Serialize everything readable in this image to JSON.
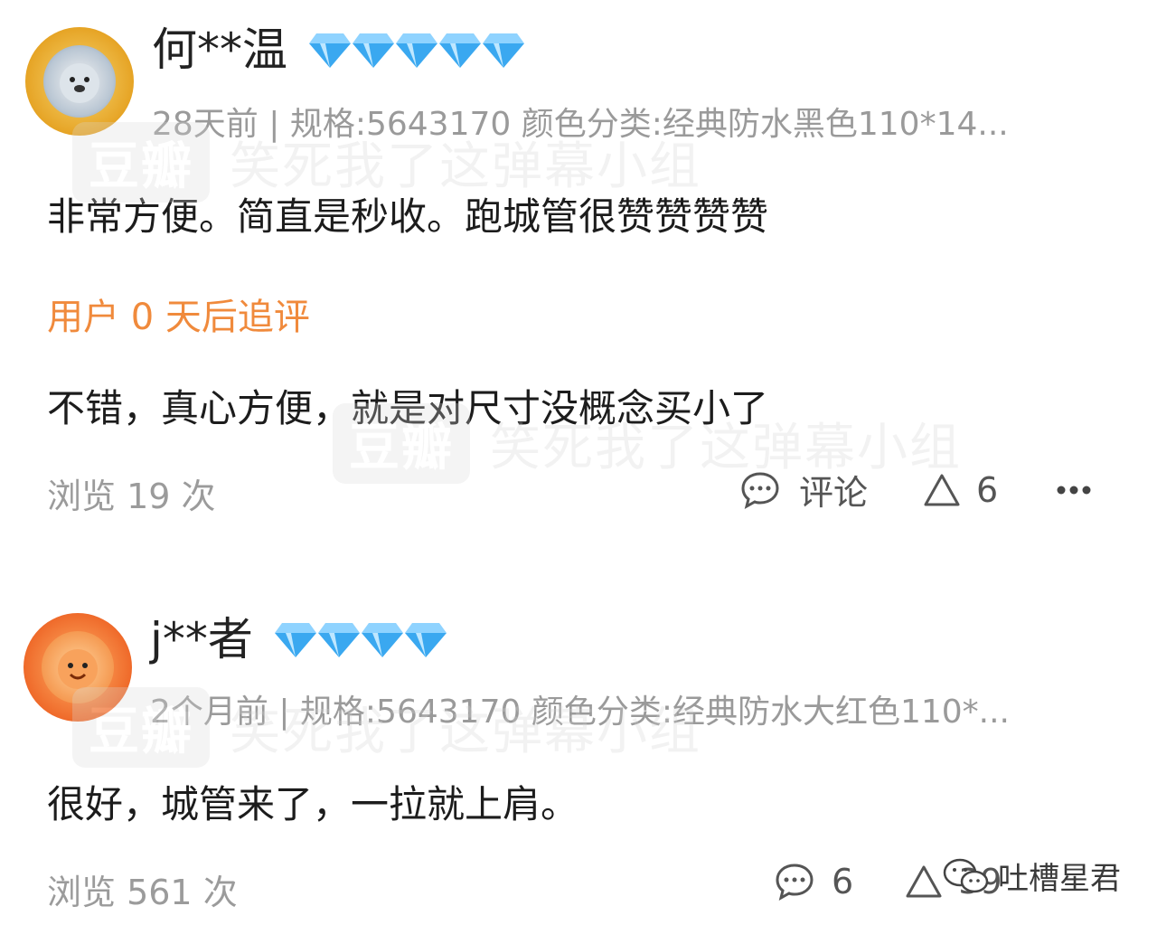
{
  "watermark": {
    "logo": "豆瓣",
    "text": "笑死我了这弹幕小组"
  },
  "reviews": [
    {
      "username": "何**温",
      "diamond_count": 5,
      "meta": "28天前 | 规格:5643170 颜色分类:经典防水黑色110*14...",
      "text": "非常方便。简直是秒收。跑城管很赞赞赞赞",
      "follow_up_label": "用户 0 天后追评",
      "follow_up_text": "不错，真心方便，就是对尺寸没概念买小了",
      "views": "浏览 19 次",
      "comment_label": "评论",
      "likes": "6"
    },
    {
      "username": "j**者",
      "diamond_count": 4,
      "meta": "2个月前 | 规格:5643170 颜色分类:经典防水大红色110*...",
      "text": "很好，城管来了，一拉就上肩。",
      "views": "浏览 561 次",
      "comment_count": "6",
      "likes": "39"
    }
  ],
  "signature": {
    "text": "吐槽星君"
  },
  "colors": {
    "diamond": "#3aa8f0",
    "followup": "#f08a3c",
    "muted": "#9a9a9a"
  },
  "icons": [
    "comment-icon",
    "upvote-icon",
    "more-icon",
    "diamond-icon",
    "wechat-icon"
  ]
}
